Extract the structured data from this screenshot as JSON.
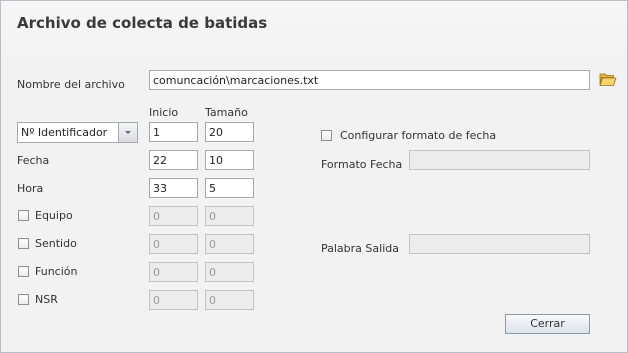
{
  "title": "Archivo de colecta de batidas",
  "file": {
    "label": "Nombre del archivo",
    "value": "comuncación\\marcaciones.txt",
    "browse_icon": "folder-open-icon"
  },
  "columns": {
    "inicio": "Inicio",
    "tamano": "Tamaño"
  },
  "identifier": {
    "selected": "Nº Identificador",
    "inicio": "1",
    "tamano": "20"
  },
  "fecha": {
    "label": "Fecha",
    "inicio": "22",
    "tamano": "10"
  },
  "hora": {
    "label": "Hora",
    "inicio": "33",
    "tamano": "5"
  },
  "equipo": {
    "label": "Equipo",
    "checked": false,
    "inicio": "0",
    "tamano": "0"
  },
  "sentido": {
    "label": "Sentido",
    "checked": false,
    "inicio": "0",
    "tamano": "0"
  },
  "funcion": {
    "label": "Función",
    "checked": false,
    "inicio": "0",
    "tamano": "0"
  },
  "nsr": {
    "label": "NSR",
    "checked": false,
    "inicio": "0",
    "tamano": "0"
  },
  "date_format": {
    "configure_label": "Configurar formato de fecha",
    "configure_checked": false,
    "format_label": "Formato Fecha",
    "format_value": ""
  },
  "exit_word": {
    "label": "Palabra Salida",
    "value": ""
  },
  "close_button": "Cerrar"
}
